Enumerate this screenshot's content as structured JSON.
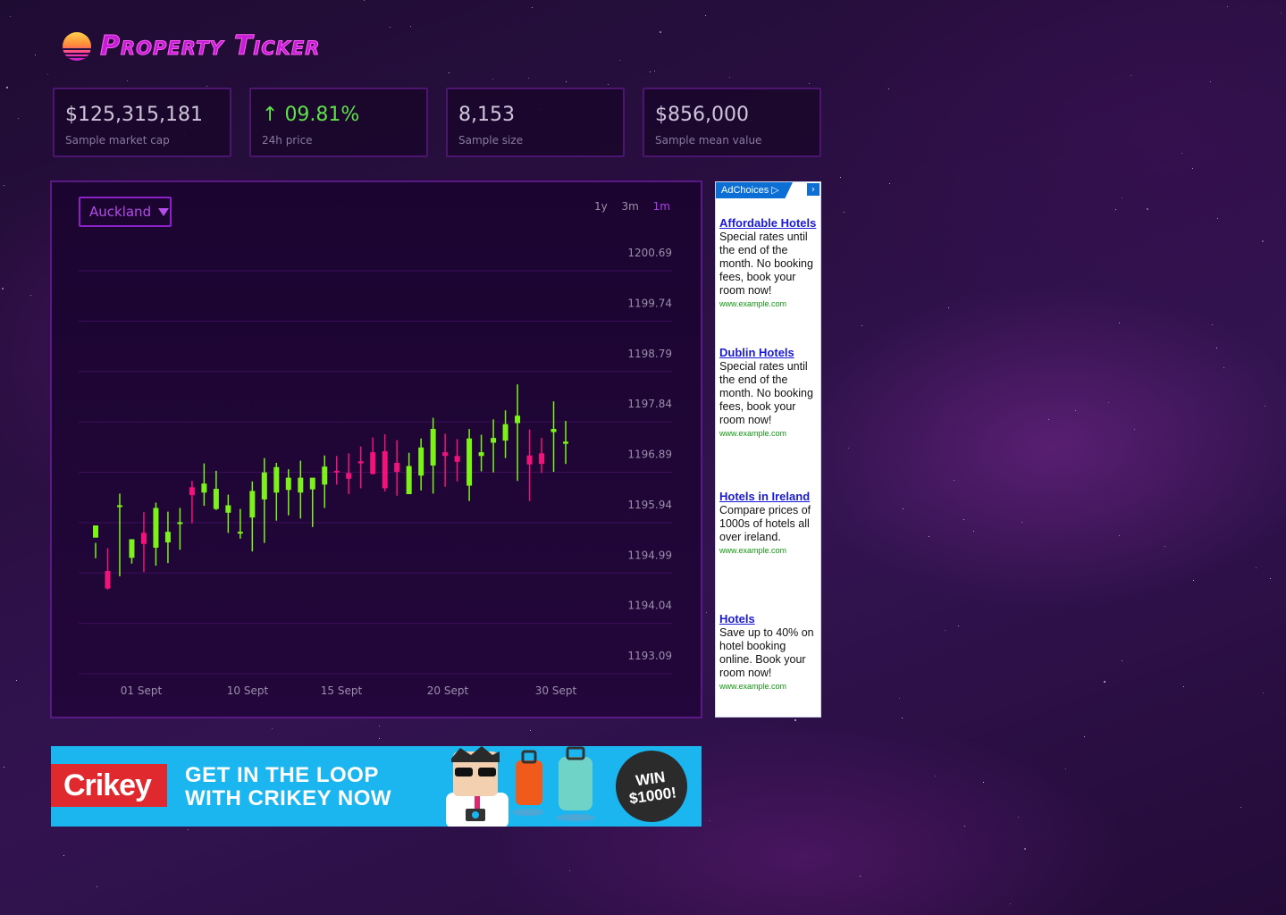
{
  "app": {
    "title": "Property Ticker",
    "logo_icon": "sunset-icon"
  },
  "stats": [
    {
      "value": "$125,315,181",
      "label": "Sample market cap"
    },
    {
      "value": "09.81%",
      "label": "24h price",
      "arrow": "↑",
      "color": "#5fe14a"
    },
    {
      "value": "8,153",
      "label": "Sample size"
    },
    {
      "value": "$856,000",
      "label": "Sample mean value"
    }
  ],
  "controls": {
    "region": "Auckland",
    "ranges": [
      "1y",
      "3m",
      "1m"
    ],
    "active_range": "1m"
  },
  "chart_data": {
    "type": "candlestick",
    "title": "",
    "xlabel": "",
    "ylabel": "",
    "y_ticks": [
      "1200.69",
      "1199.74",
      "1198.79",
      "1197.84",
      "1196.89",
      "1195.94",
      "1194.99",
      "1194.04",
      "1193.09"
    ],
    "ylim": [
      1193.09,
      1200.69
    ],
    "x_ticks": [
      "01 Sept",
      "10 Sept",
      "15 Sept",
      "20 Sept",
      "30 Sept"
    ],
    "grid": true,
    "up_color": "#7cf21a",
    "down_color": "#f0147a",
    "candles": [
      [
        1195.32,
        1195.55,
        1194.93,
        1195.22
      ],
      [
        1194.69,
        1194.36,
        1195.12,
        1194.34
      ],
      [
        1195.91,
        1195.93,
        1196.15,
        1194.59
      ],
      [
        1194.94,
        1195.29,
        1195.17,
        1194.83
      ],
      [
        1195.41,
        1195.2,
        1195.8,
        1194.67
      ],
      [
        1195.13,
        1195.88,
        1195.98,
        1194.79
      ],
      [
        1195.23,
        1195.43,
        1195.81,
        1194.84
      ],
      [
        1195.6,
        1195.61,
        1195.88,
        1195.09
      ],
      [
        1196.27,
        1196.12,
        1196.39,
        1195.59
      ],
      [
        1196.17,
        1196.34,
        1196.72,
        1195.92
      ],
      [
        1195.86,
        1196.24,
        1196.58,
        1195.84
      ],
      [
        1195.79,
        1195.93,
        1196.13,
        1195.41
      ],
      [
        1195.42,
        1195.43,
        1195.86,
        1195.3
      ],
      [
        1195.7,
        1196.2,
        1196.38,
        1195.06
      ],
      [
        1196.04,
        1196.55,
        1196.82,
        1195.22
      ],
      [
        1196.17,
        1196.65,
        1196.73,
        1195.64
      ],
      [
        1196.22,
        1196.45,
        1196.61,
        1195.74
      ],
      [
        1196.17,
        1196.45,
        1196.77,
        1195.68
      ],
      [
        1196.23,
        1196.45,
        1196.41,
        1195.52
      ],
      [
        1196.32,
        1196.66,
        1196.87,
        1195.88
      ],
      [
        1196.58,
        1196.57,
        1196.86,
        1196.32
      ],
      [
        1196.54,
        1196.43,
        1196.91,
        1196.14
      ],
      [
        1196.76,
        1196.72,
        1197.04,
        1196.25
      ],
      [
        1196.93,
        1196.52,
        1197.21,
        1196.51
      ],
      [
        1196.95,
        1196.25,
        1197.27,
        1196.19
      ],
      [
        1196.73,
        1196.56,
        1197.16,
        1196.11
      ],
      [
        1196.14,
        1196.67,
        1196.92,
        1196.26
      ],
      [
        1196.49,
        1197.02,
        1197.19,
        1196.21
      ],
      [
        1196.68,
        1197.37,
        1197.58,
        1196.15
      ],
      [
        1196.93,
        1196.86,
        1197.28,
        1196.28
      ],
      [
        1196.86,
        1196.75,
        1197.18,
        1196.38
      ],
      [
        1196.3,
        1197.19,
        1197.37,
        1196.01
      ],
      [
        1196.86,
        1196.93,
        1197.26,
        1196.57
      ],
      [
        1197.11,
        1197.2,
        1197.55,
        1196.55
      ],
      [
        1197.15,
        1197.46,
        1197.72,
        1196.82
      ],
      [
        1197.48,
        1197.62,
        1198.21,
        1196.39
      ],
      [
        1196.87,
        1196.7,
        1197.36,
        1196.01
      ],
      [
        1196.91,
        1196.71,
        1197.2,
        1196.54
      ],
      [
        1197.31,
        1197.37,
        1197.89,
        1196.56
      ],
      [
        1197.09,
        1197.13,
        1197.52,
        1196.71
      ]
    ]
  },
  "side_ad": {
    "adchoices": "AdChoices",
    "items": [
      {
        "title": "Affordable Hotels",
        "desc": "Special rates until the end of the month. No booking fees, book your room now!",
        "url": "www.example.com"
      },
      {
        "title": "Dublin Hotels",
        "desc": "Special rates until the end of the month. No booking fees, book your room now!",
        "url": "www.example.com"
      },
      {
        "title": "Hotels in Ireland",
        "desc": "Compare prices of 1000s of hotels all over ireland.",
        "url": "www.example.com"
      },
      {
        "title": "Hotels",
        "desc": "Save up to 40% on hotel booking online. Book your room now!",
        "url": "www.example.com"
      }
    ]
  },
  "banner": {
    "brand": "Crikey",
    "line1": "GET IN THE LOOP",
    "line2": "WITH CRIKEY NOW",
    "badge1": "WIN",
    "badge2": "$1000!"
  }
}
